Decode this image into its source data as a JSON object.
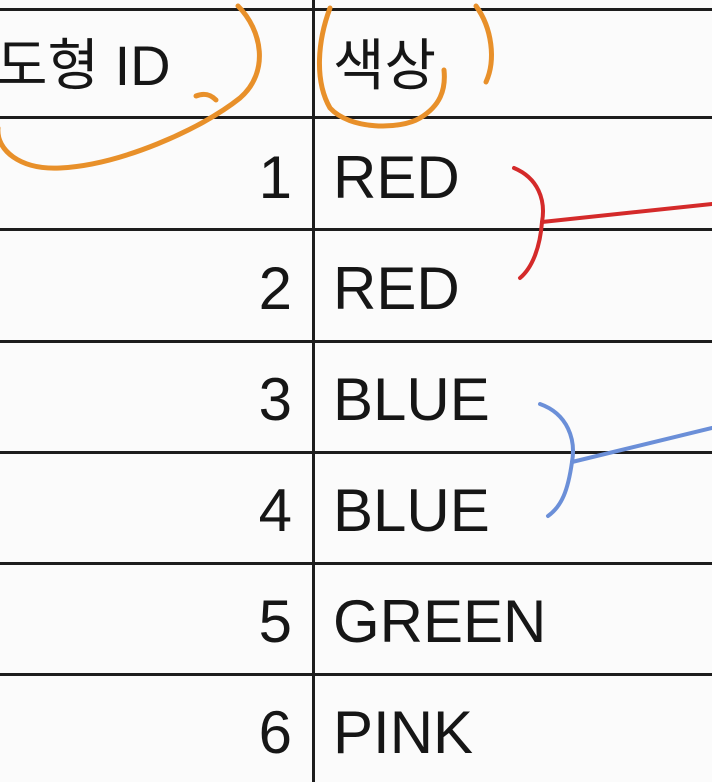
{
  "table": {
    "headers": {
      "id": "도형 ID",
      "color": "색상"
    },
    "rows": [
      {
        "id": "1",
        "color": "RED"
      },
      {
        "id": "2",
        "color": "RED"
      },
      {
        "id": "3",
        "color": "BLUE"
      },
      {
        "id": "4",
        "color": "BLUE"
      },
      {
        "id": "5",
        "color": "GREEN"
      },
      {
        "id": "6",
        "color": "PINK"
      }
    ]
  },
  "annotations": {
    "header_circle_color": "#e8902a",
    "red_bracket_color": "#d42a2a",
    "blue_bracket_color": "#6b8fd8"
  }
}
